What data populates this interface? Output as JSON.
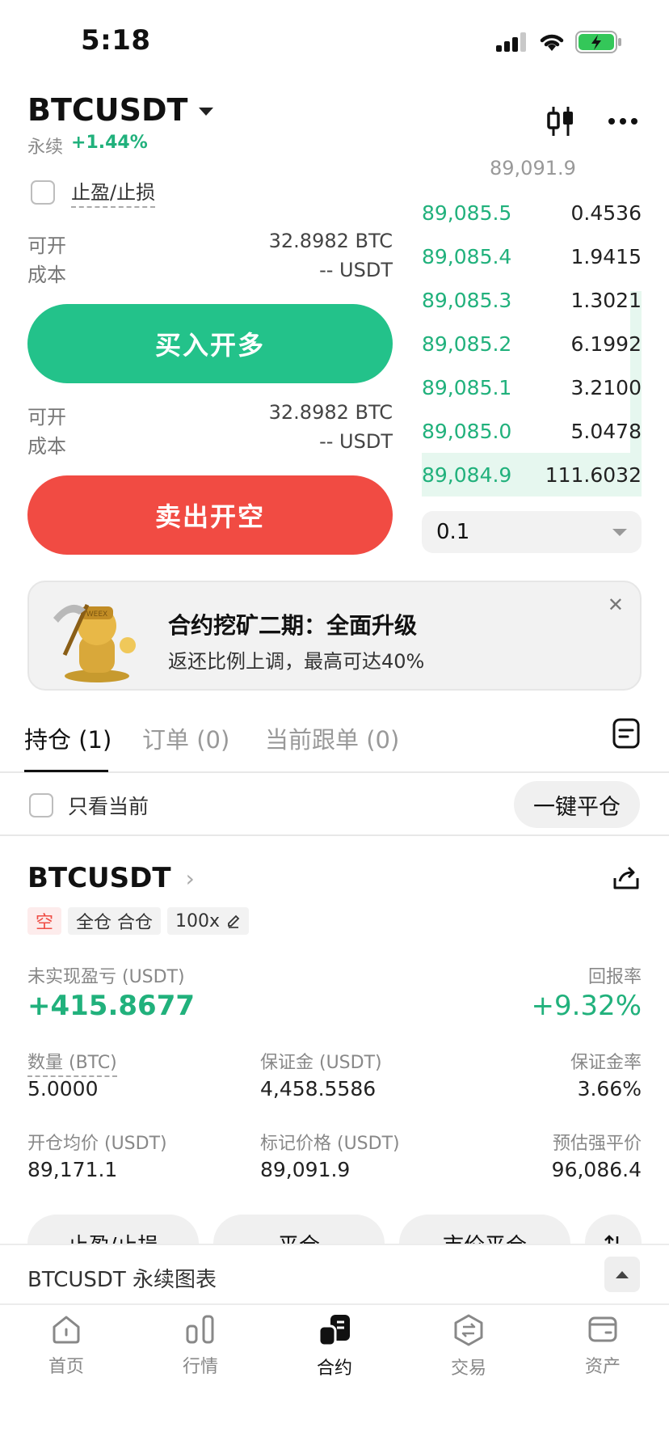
{
  "status_bar": {
    "time": "5:18"
  },
  "header": {
    "pair": "BTCUSDT",
    "type": "永续",
    "change": "+1.44%"
  },
  "form": {
    "tp_sl_label": "止盈/止损",
    "buy": {
      "avail_label": "可开",
      "avail_value": "32.8982 BTC",
      "cost_label": "成本",
      "cost_value": "-- USDT",
      "button": "买入开多"
    },
    "sell": {
      "avail_label": "可开",
      "avail_value": "32.8982 BTC",
      "cost_label": "成本",
      "cost_value": "-- USDT",
      "button": "卖出开空"
    }
  },
  "orderbook": {
    "top_price": "89,091.9",
    "rows": [
      {
        "price": "89,085.5",
        "qty": "0.4536"
      },
      {
        "price": "89,085.4",
        "qty": "1.9415"
      },
      {
        "price": "89,085.3",
        "qty": "1.3021"
      },
      {
        "price": "89,085.2",
        "qty": "6.1992"
      },
      {
        "price": "89,085.1",
        "qty": "3.2100"
      },
      {
        "price": "89,085.0",
        "qty": "5.0478"
      },
      {
        "price": "89,084.9",
        "qty": "111.6032"
      }
    ],
    "precision": "0.1"
  },
  "banner": {
    "title": "合约挖矿二期：全面升级",
    "subtitle": "返还比例上调，最高可达40%",
    "mascot_text": "WEEX"
  },
  "tabs": [
    {
      "label": "持仓 (1)"
    },
    {
      "label": "订单 (0)"
    },
    {
      "label": "当前跟单 (0)"
    }
  ],
  "filter": {
    "only_current": "只看当前",
    "close_all": "一键平仓"
  },
  "position": {
    "symbol": "BTCUSDT",
    "tags": {
      "side": "空",
      "mode": "全仓 合仓",
      "leverage": "100x"
    },
    "pnl_label": "未实现盈亏 (USDT)",
    "pnl_value": "+415.8677",
    "roe_label": "回报率",
    "roe_value": "+9.32%",
    "qty_label": "数量 (BTC)",
    "qty_value": "5.0000",
    "margin_label": "保证金 (USDT)",
    "margin_value": "4,458.5586",
    "margin_rate_label": "保证金率",
    "margin_rate_value": "3.66%",
    "entry_label": "开仓均价 (USDT)",
    "entry_value": "89,171.1",
    "mark_label": "标记价格 (USDT)",
    "mark_value": "89,091.9",
    "liq_label": "预估强平价",
    "liq_value": "96,086.4",
    "actions": [
      "止盈/止损",
      "平仓",
      "市价平仓"
    ]
  },
  "chart_bar": {
    "label": "BTCUSDT 永续图表"
  },
  "nav": [
    {
      "label": "首页"
    },
    {
      "label": "行情"
    },
    {
      "label": "合约"
    },
    {
      "label": "交易"
    },
    {
      "label": "资产"
    }
  ],
  "colors": {
    "green": "#23c28a",
    "red": "#f14b43"
  }
}
